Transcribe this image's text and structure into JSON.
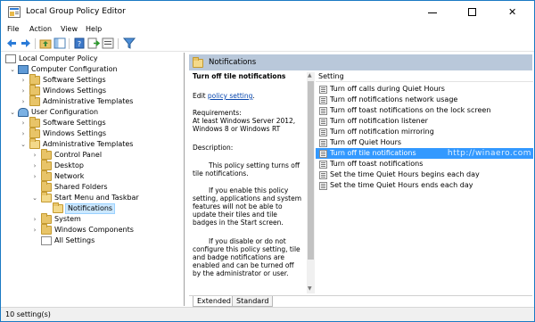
{
  "window": {
    "title": "Local Group Policy Editor",
    "app_icon": "group-policy-icon",
    "controls": {
      "minimize": "minimize-icon",
      "maximize": "maximize-icon",
      "close": "close-icon",
      "close_glyph": "✕"
    }
  },
  "menu": [
    "File",
    "Action",
    "View",
    "Help"
  ],
  "toolbar": [
    "back-arrow-icon",
    "forward-arrow-icon",
    "up-folder-icon",
    "show-hide-tree-icon",
    "help-book-icon",
    "export-list-icon",
    "properties-icon",
    "filter-icon"
  ],
  "tree": {
    "root": "Local Computer Policy",
    "computer_configuration": "Computer Configuration",
    "cc_software_settings": "Software Settings",
    "cc_windows_settings": "Windows Settings",
    "cc_admin_templates": "Administrative Templates",
    "user_configuration": "User Configuration",
    "uc_software_settings": "Software Settings",
    "uc_windows_settings": "Windows Settings",
    "uc_admin_templates": "Administrative Templates",
    "control_panel": "Control Panel",
    "desktop": "Desktop",
    "network": "Network",
    "shared_folders": "Shared Folders",
    "start_menu_taskbar": "Start Menu and Taskbar",
    "notifications": "Notifications",
    "system": "System",
    "windows_components": "Windows Components",
    "all_settings": "All Settings"
  },
  "right_pane": {
    "header": "Notifications",
    "description": {
      "title": "Turn off tile notifications",
      "edit_prefix": "Edit ",
      "edit_link": "policy setting",
      "edit_suffix": ".",
      "requirements": "Requirements:\nAt least Windows Server 2012, Windows 8 or Windows RT",
      "description_label": "Description:",
      "p1": "This policy setting turns off tile notifications.",
      "p2": "If you enable this policy setting, applications and system features will not be able to update their tiles and tile badges in the Start screen.",
      "p3": "If you disable or do not configure this policy setting, tile and badge notifications are enabled and can be turned off by the administrator or user."
    },
    "settings_column": "Setting",
    "settings": [
      "Turn off calls during Quiet Hours",
      "Turn off notifications network usage",
      "Turn off toast notifications on the lock screen",
      "Turn off notification listener",
      "Turn off notification mirroring",
      "Turn off Quiet Hours",
      "Turn off tile notifications",
      "Turn off toast notifications",
      "Set the time Quiet Hours begins each day",
      "Set the time Quiet Hours ends each day"
    ],
    "selected_index": 6,
    "watermark": "http://winaero.com",
    "tabs": [
      "Extended",
      "Standard"
    ],
    "active_tab": "Extended"
  },
  "status": "10 setting(s)",
  "colors": {
    "selection": "#3399ff",
    "header_bar": "#b9c8da",
    "tree_selection": "#cce8ff",
    "border": "#1b7ac4"
  }
}
